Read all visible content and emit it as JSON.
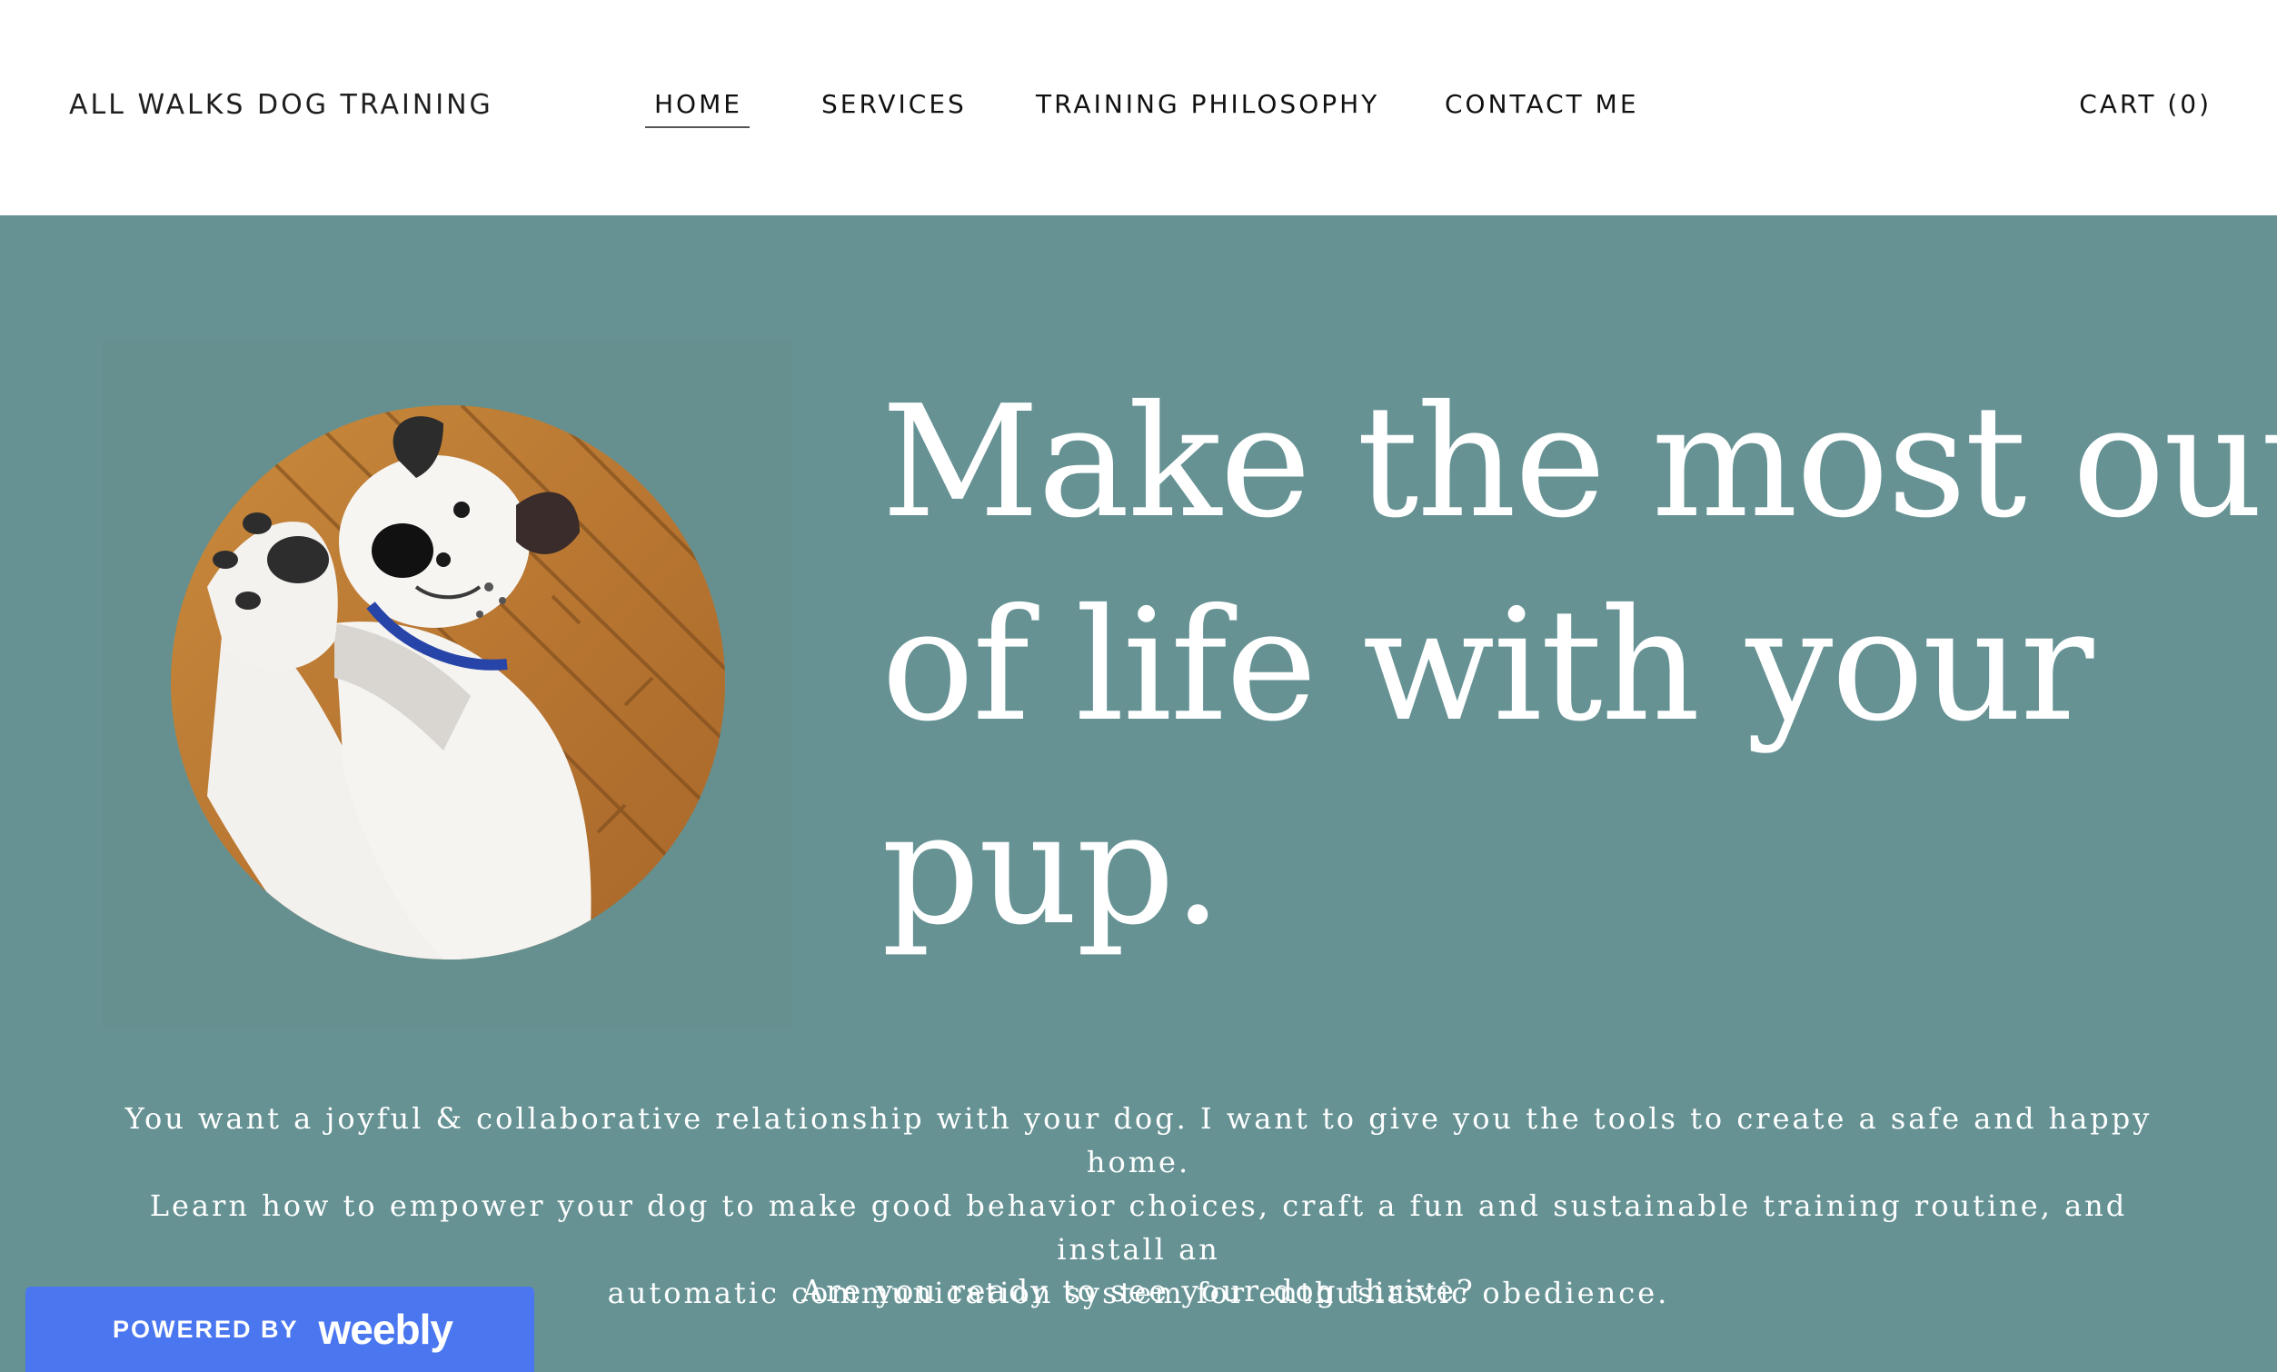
{
  "header": {
    "site_title": "ALL WALKS DOG TRAINING",
    "nav": [
      "HOME",
      "SERVICES",
      "TRAINING PHILOSOPHY",
      "CONTACT ME"
    ],
    "active_nav": "HOME",
    "cart_label": "CART (0)"
  },
  "hero": {
    "background_color": "#669294",
    "headline_lines": [
      "Make the most out",
      "of life with your",
      "pup."
    ],
    "body_lines": [
      "You want a joyful & collaborative relationship with your dog. I want to give you the tools to create a safe and happy home.",
      "Learn how to empower your dog to make good behavior choices, craft a fun and sustainable training routine, and install an",
      "automatic communication system for enthusiastic obedience."
    ],
    "question": "Are you ready to see your dog thrive?",
    "image": "dog-photo"
  },
  "badge": {
    "powered_label": "POWERED BY",
    "brand": "weebly",
    "color": "#4a77f0"
  }
}
